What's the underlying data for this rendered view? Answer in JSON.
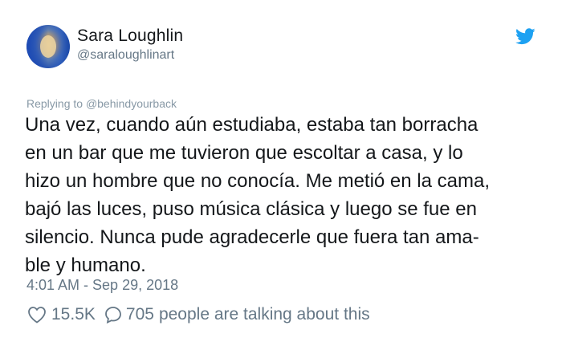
{
  "tweet": {
    "author_name": "Sara Loughlin",
    "author_handle": "@saraloughlinart",
    "replying_prefix": "Replying to",
    "replying_to": "@behindyourback",
    "text_lines": [
      "Una vez, cuando aún estudiaba, estaba tan borracha",
      "en un bar que me tuvieron que escoltar a casa, y lo",
      "hizo un hombre que no conocía. Me metió en la cama,",
      "bajó las luces, puso música clásica y luego se fue en",
      "silencio. Nunca pude agradecerle que fuera tan ama-",
      "ble y humano."
    ],
    "timestamp": "4:01 AM - Sep 29, 2018",
    "like_count": "15.5K",
    "reply_count": "705",
    "talking_text": "people are talking about this"
  },
  "icons": {
    "logo": "twitter-bird-icon",
    "like": "heart-icon",
    "reply": "speech-bubble-icon"
  },
  "colors": {
    "twitter_blue": "#1da1f2",
    "secondary_text": "#657786",
    "primary_text": "#14171a"
  }
}
